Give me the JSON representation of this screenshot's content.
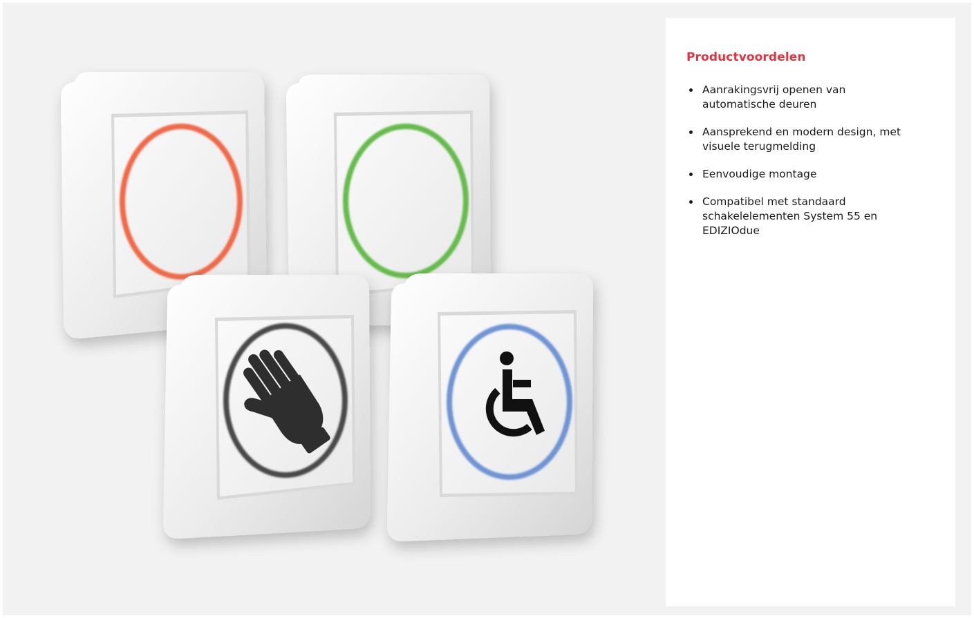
{
  "panel": {
    "title": "Productvoordelen",
    "benefits": [
      "Aanrakingsvrij openen van automatische deuren",
      "Aansprekend en modern design, met visuele terugmelding",
      "Eenvoudige montage",
      "Compatibel met standaard schakelelementen System 55 en EDIZIOdue"
    ]
  },
  "image": {
    "switches": [
      {
        "name": "red-ring-switch",
        "ring_color": "#f06a4a",
        "symbol": "none"
      },
      {
        "name": "green-ring-switch",
        "ring_color": "#66bb4e",
        "symbol": "none"
      },
      {
        "name": "hand-switch",
        "ring_color": "#4a4a4a",
        "symbol": "hand-icon"
      },
      {
        "name": "wheelchair-switch",
        "ring_color": "#6f94d4",
        "symbol": "wheelchair-icon"
      }
    ]
  },
  "colors": {
    "accent": "#e2333f",
    "background": "#f2f2f2",
    "panel": "#ffffff"
  }
}
